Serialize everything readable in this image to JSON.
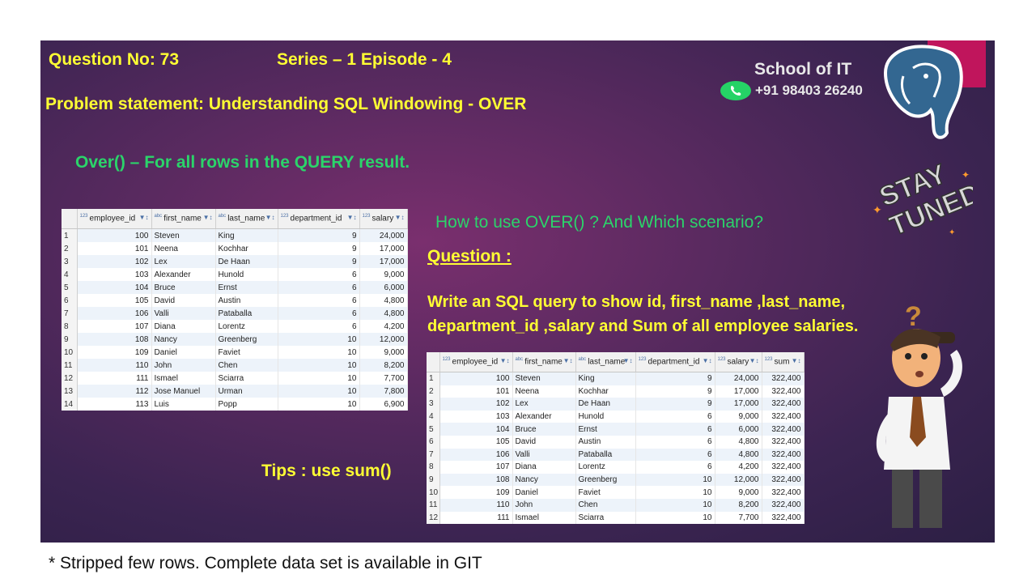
{
  "header": {
    "question_no": "Question No: 73",
    "series": "Series – 1 Episode - 4",
    "problem": "Problem statement: Understanding SQL Windowing - OVER",
    "over_line": "Over() – For all rows in the QUERY result."
  },
  "branding": {
    "school": "School of IT",
    "phone": "+91 98403 26240"
  },
  "how_to": "How to use OVER() ? And Which scenario?",
  "question": {
    "heading": "Question :",
    "line1": "Write an SQL query to show id, first_name ,last_name,",
    "line2": "department_id ,salary and Sum of all employee salaries."
  },
  "tips": "Tips : use sum()",
  "footnote": "* Stripped few rows. Complete data set is available in GIT",
  "stay_tuned": [
    "STAY",
    "TUNED"
  ],
  "table1": {
    "columns": [
      "employee_id",
      "first_name",
      "last_name",
      "department_id",
      "salary"
    ],
    "rows": [
      [
        "1",
        "100",
        "Steven",
        "King",
        "9",
        "24,000"
      ],
      [
        "2",
        "101",
        "Neena",
        "Kochhar",
        "9",
        "17,000"
      ],
      [
        "3",
        "102",
        "Lex",
        "De Haan",
        "9",
        "17,000"
      ],
      [
        "4",
        "103",
        "Alexander",
        "Hunold",
        "6",
        "9,000"
      ],
      [
        "5",
        "104",
        "Bruce",
        "Ernst",
        "6",
        "6,000"
      ],
      [
        "6",
        "105",
        "David",
        "Austin",
        "6",
        "4,800"
      ],
      [
        "7",
        "106",
        "Valli",
        "Pataballa",
        "6",
        "4,800"
      ],
      [
        "8",
        "107",
        "Diana",
        "Lorentz",
        "6",
        "4,200"
      ],
      [
        "9",
        "108",
        "Nancy",
        "Greenberg",
        "10",
        "12,000"
      ],
      [
        "10",
        "109",
        "Daniel",
        "Faviet",
        "10",
        "9,000"
      ],
      [
        "11",
        "110",
        "John",
        "Chen",
        "10",
        "8,200"
      ],
      [
        "12",
        "111",
        "Ismael",
        "Sciarra",
        "10",
        "7,700"
      ],
      [
        "13",
        "112",
        "Jose Manuel",
        "Urman",
        "10",
        "7,800"
      ],
      [
        "14",
        "113",
        "Luis",
        "Popp",
        "10",
        "6,900"
      ]
    ]
  },
  "table2": {
    "columns": [
      "employee_id",
      "first_name",
      "last_name",
      "department_id",
      "salary",
      "sum"
    ],
    "rows": [
      [
        "1",
        "100",
        "Steven",
        "King",
        "9",
        "24,000",
        "322,400"
      ],
      [
        "2",
        "101",
        "Neena",
        "Kochhar",
        "9",
        "17,000",
        "322,400"
      ],
      [
        "3",
        "102",
        "Lex",
        "De Haan",
        "9",
        "17,000",
        "322,400"
      ],
      [
        "4",
        "103",
        "Alexander",
        "Hunold",
        "6",
        "9,000",
        "322,400"
      ],
      [
        "5",
        "104",
        "Bruce",
        "Ernst",
        "6",
        "6,000",
        "322,400"
      ],
      [
        "6",
        "105",
        "David",
        "Austin",
        "6",
        "4,800",
        "322,400"
      ],
      [
        "7",
        "106",
        "Valli",
        "Pataballa",
        "6",
        "4,800",
        "322,400"
      ],
      [
        "8",
        "107",
        "Diana",
        "Lorentz",
        "6",
        "4,200",
        "322,400"
      ],
      [
        "9",
        "108",
        "Nancy",
        "Greenberg",
        "10",
        "12,000",
        "322,400"
      ],
      [
        "10",
        "109",
        "Daniel",
        "Faviet",
        "10",
        "9,000",
        "322,400"
      ],
      [
        "11",
        "110",
        "John",
        "Chen",
        "10",
        "8,200",
        "322,400"
      ],
      [
        "12",
        "111",
        "Ismael",
        "Sciarra",
        "10",
        "7,700",
        "322,400"
      ]
    ]
  }
}
